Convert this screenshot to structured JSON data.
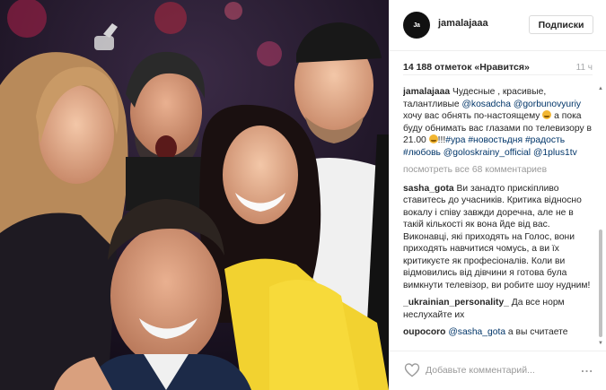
{
  "post": {
    "username": "jamalajaaa",
    "avatar_text": "Ja",
    "follow_label": "Подписки",
    "likes": "14 188 отметок «Нравится»",
    "time": "11 ч"
  },
  "caption": {
    "user": "jamalajaaa",
    "text_1": " Чудесные , красивые, талантливые ",
    "mention_1": "@kosadcha",
    "text_2": " ",
    "mention_2": "@gorbunovyuriy",
    "text_3": " хочу вас обнять по-настоящему ",
    "text_4": " а пока буду обнимать вас глазами по телевизору в 21.00 ",
    "text_5": "!!!",
    "tag_1": "#ура",
    "tag_2": "#новостьдня",
    "tag_3": "#радость",
    "tag_4": "#любовь",
    "mention_3": "@goloskrainy_official",
    "mention_4": "@1plus1tv"
  },
  "load_more": "посмотреть все 68 комментариев",
  "comments": [
    {
      "user": "sasha_gota",
      "text": " Ви занадто прискіпливо ставитесь до учасників. Критика відносно вокалу і співу завжди доречна, але не в такій кількості як вона йде від вас. Виконавці, які приходять на Голос, вони приходять навчитися чомусь, а ви їх критикуєте як професіоналів. Коли ви відмовились від дівчини я готова була вимкнути телевізор, ви робите шоу нудним!"
    },
    {
      "user": "_ukrainian_personality_",
      "text": " Да все норм неслухайте их"
    },
    {
      "user": "oupocoro",
      "mention": "@sasha_gota",
      "text": " а вы считаете"
    }
  ],
  "footer": {
    "placeholder": "Добавьте комментарий...",
    "more": "..."
  },
  "icons": {
    "heart": "heart-icon",
    "more": "more-options-icon",
    "scroll_up": "scroll-up-arrow-icon",
    "scroll_down": "scroll-down-arrow-icon"
  },
  "colors": {
    "link": "#003569",
    "muted": "#999999",
    "border": "#efefef",
    "text": "#262626"
  }
}
